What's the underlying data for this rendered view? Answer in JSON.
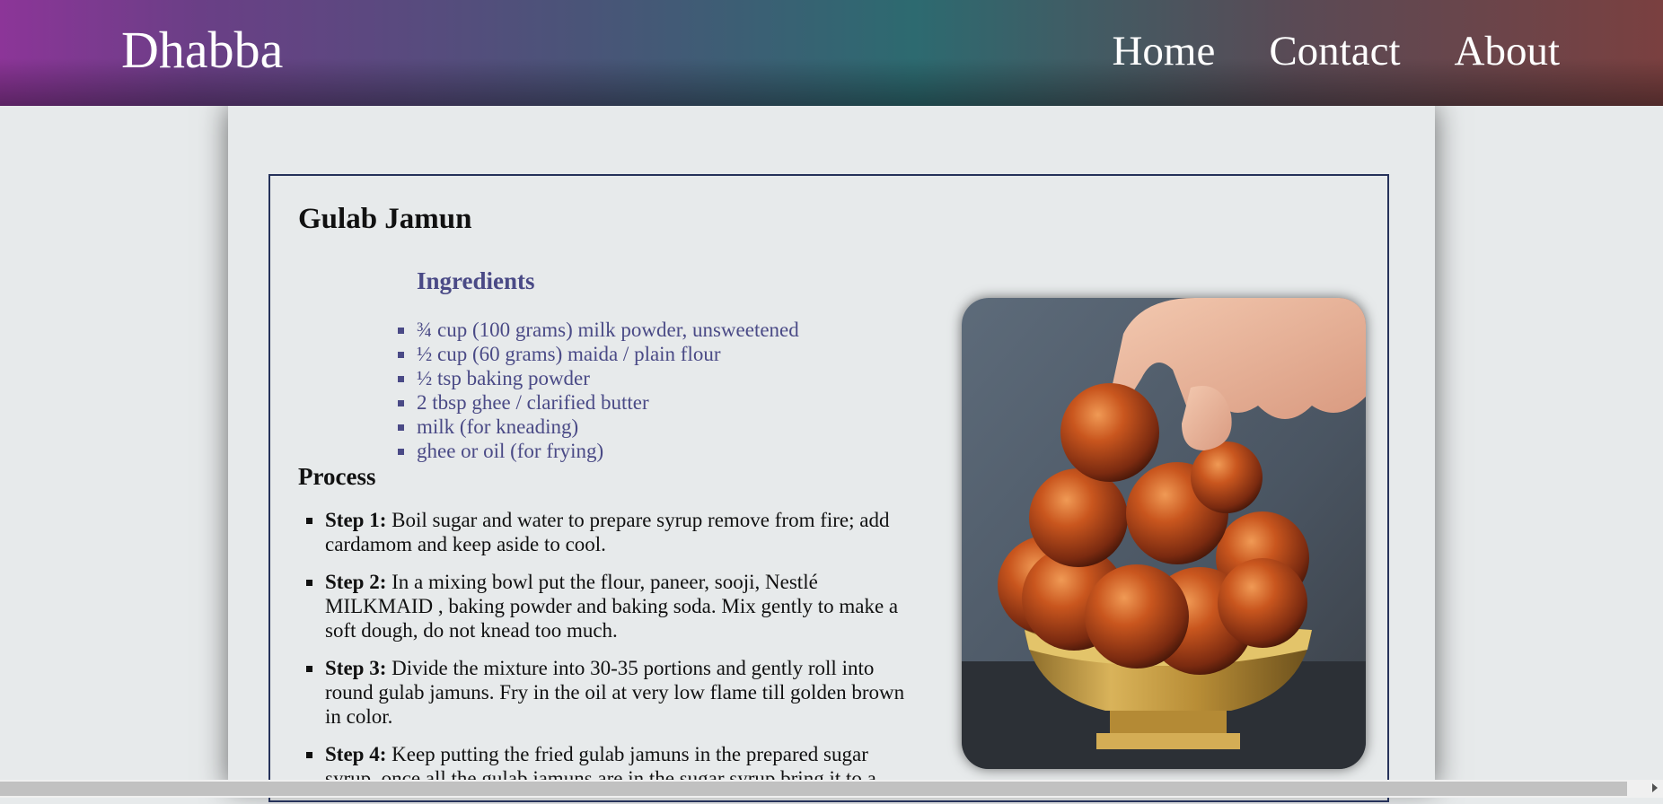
{
  "navbar": {
    "brand": "Dhabba",
    "links": [
      "Home",
      "Contact",
      "About"
    ]
  },
  "recipe": {
    "title": "Gulab Jamun",
    "ingredients_heading": "Ingredients",
    "ingredients": [
      "¾ cup (100 grams) milk powder, unsweetened",
      "½ cup (60 grams) maida / plain flour",
      "½ tsp baking powder",
      "2 tbsp ghee / clarified butter",
      "milk (for kneading)",
      "ghee or oil (for frying)"
    ],
    "process_heading": "Process",
    "steps": [
      {
        "label": "Step 1:",
        "text": " Boil sugar and water to prepare syrup remove from fire; add cardamom and keep aside to cool."
      },
      {
        "label": "Step 2:",
        "text": " In a mixing bowl put the flour, paneer, sooji, Nestlé MILKMAID , baking powder and baking soda. Mix gently to make a soft dough, do not knead too much."
      },
      {
        "label": "Step 3:",
        "text": " Divide the mixture into 30-35 portions and gently roll into round gulab jamuns. Fry in the oil at very low flame till golden brown in color."
      },
      {
        "label": "Step 4:",
        "text": " Keep putting the fried gulab jamuns in the prepared sugar syrup, once all the gulab jamuns are in the sugar syrup bring it to a"
      }
    ]
  }
}
